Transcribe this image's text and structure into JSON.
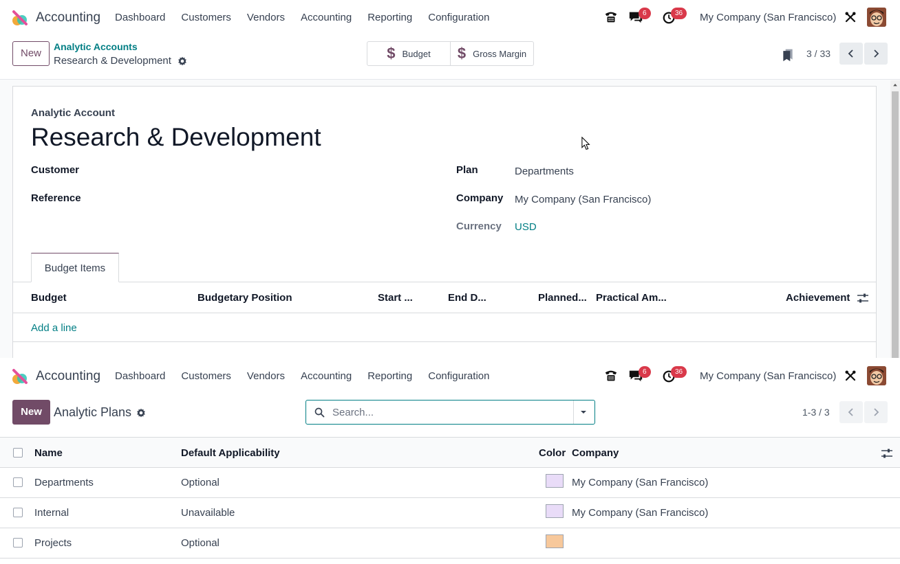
{
  "top": {
    "navbar": {
      "app_name": "Accounting",
      "menu": [
        "Dashboard",
        "Customers",
        "Vendors",
        "Accounting",
        "Reporting",
        "Configuration"
      ],
      "chat_badge": "6",
      "activity_badge": "36",
      "company": "My Company (San Francisco)"
    },
    "control": {
      "new_label": "New",
      "breadcrumb_parent": "Analytic Accounts",
      "breadcrumb_current": "Research & Development",
      "smart_buttons": [
        "Budget",
        "Gross Margin"
      ],
      "pager": "3 / 33"
    },
    "form": {
      "type_label": "Analytic Account",
      "title": "Research & Development",
      "left_fields": [
        {
          "label": "Customer",
          "value": ""
        },
        {
          "label": "Reference",
          "value": ""
        }
      ],
      "right_fields": [
        {
          "label": "Plan",
          "value": "Departments"
        },
        {
          "label": "Company",
          "value": "My Company (San Francisco)"
        },
        {
          "label": "Currency",
          "value": "USD"
        }
      ],
      "tab": "Budget Items",
      "columns": [
        "Budget",
        "Budgetary Position",
        "Start ...",
        "End D...",
        "Planned...",
        "Practical Am...",
        "Achievement"
      ],
      "add_line": "Add a line"
    }
  },
  "bottom": {
    "navbar": {
      "app_name": "Accounting",
      "menu": [
        "Dashboard",
        "Customers",
        "Vendors",
        "Accounting",
        "Reporting",
        "Configuration"
      ],
      "chat_badge": "6",
      "activity_badge": "36",
      "company": "My Company (San Francisco)"
    },
    "control": {
      "new_label": "New",
      "title": "Analytic Plans",
      "search_placeholder": "Search...",
      "pager": "1-3 / 3"
    },
    "list": {
      "columns": [
        "Name",
        "Default Applicability",
        "Color",
        "Company"
      ],
      "rows": [
        {
          "name": "Departments",
          "applicability": "Optional",
          "color": "#e9dcf8",
          "company": "My Company (San Francisco)"
        },
        {
          "name": "Internal",
          "applicability": "Unavailable",
          "color": "#e9dcf8",
          "company": "My Company (San Francisco)"
        },
        {
          "name": "Projects",
          "applicability": "Optional",
          "color": "#f7c89b",
          "company": ""
        }
      ]
    }
  },
  "colors": {
    "brand": "#714b67",
    "link": "#017e84",
    "badge": "#d9394a"
  }
}
